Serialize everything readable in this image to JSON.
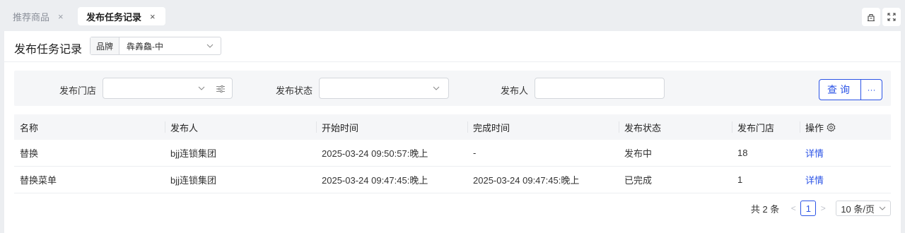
{
  "tabs": [
    {
      "label": "推荐商品",
      "close": "×"
    },
    {
      "label": "发布任务记录",
      "close": "×"
    }
  ],
  "header": {
    "title": "发布任务记录",
    "brand_label": "品牌",
    "brand_value": "犇羴鱻-中"
  },
  "filters": {
    "store_label": "发布门店",
    "status_label": "发布状态",
    "publisher_label": "发布人",
    "query_label": "查询",
    "more_label": "···"
  },
  "table": {
    "headers": [
      "名称",
      "发布人",
      "开始时间",
      "完成时间",
      "发布状态",
      "发布门店",
      "操作"
    ],
    "rows": [
      {
        "name": "替换",
        "publisher": "bjj连锁集团",
        "start": "2025-03-24 09:50:57:晚上",
        "finish": "-",
        "status": "发布中",
        "stores": "18",
        "action": "详情"
      },
      {
        "name": "替换菜单",
        "publisher": "bjj连锁集团",
        "start": "2025-03-24 09:47:45:晚上",
        "finish": "2025-03-24 09:47:45:晚上",
        "status": "已完成",
        "stores": "1",
        "action": "详情"
      }
    ]
  },
  "pagination": {
    "total": "共 2 条",
    "prev": "<",
    "current": "1",
    "next": ">",
    "page_size": "10 条/页"
  },
  "colors": {
    "accent": "#2c54e6"
  }
}
